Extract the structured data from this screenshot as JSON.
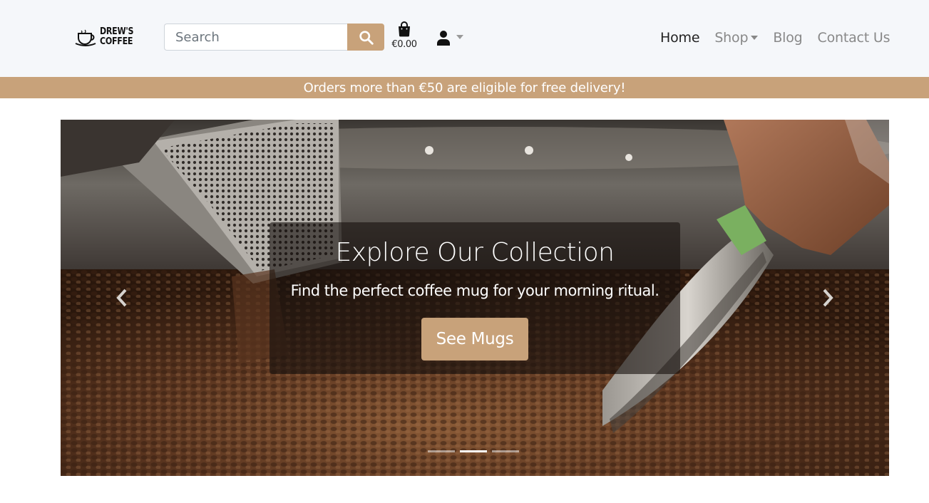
{
  "brand": {
    "logo_line1": "DREW'S",
    "logo_line2": "COFFEE"
  },
  "search": {
    "placeholder": "Search",
    "value": ""
  },
  "cart": {
    "total": "€0.00"
  },
  "nav": {
    "items": [
      {
        "label": "Home",
        "active": true,
        "dropdown": false
      },
      {
        "label": "Shop",
        "active": false,
        "dropdown": true
      },
      {
        "label": "Blog",
        "active": false,
        "dropdown": false
      },
      {
        "label": "Contact Us",
        "active": false,
        "dropdown": false
      }
    ]
  },
  "promo": {
    "text": "Orders more than €50 are eligible for free delivery!"
  },
  "carousel": {
    "title": "Explore Our Collection",
    "subtitle": "Find the perfect coffee mug for your morning ritual.",
    "cta_label": "See Mugs",
    "slide_count": 3,
    "active_index": 1
  },
  "colors": {
    "accent": "#c8a27a",
    "navbar_bg": "#f5f7fa",
    "text_dark": "#222222",
    "text_muted": "#888888"
  },
  "icons": {
    "search": "search-icon",
    "cart": "shopping-bag-icon",
    "account": "user-icon",
    "prev": "chevron-left-icon",
    "next": "chevron-right-icon"
  }
}
